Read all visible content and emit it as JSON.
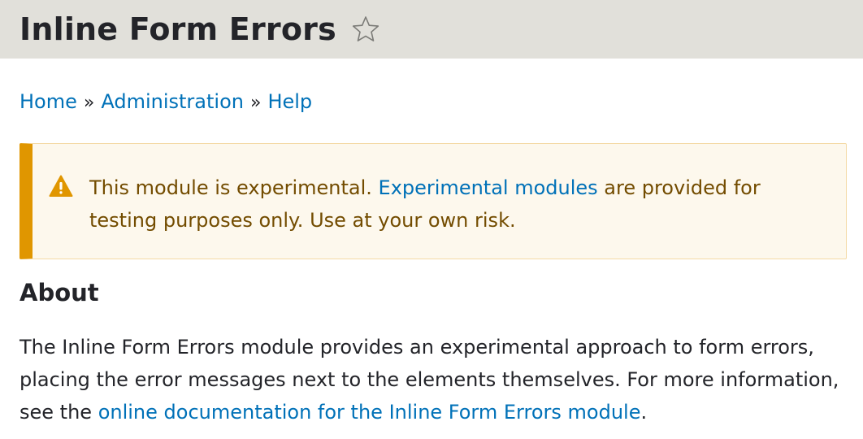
{
  "header": {
    "title": "Inline Form Errors",
    "star_icon": "star-outline-icon"
  },
  "breadcrumb": {
    "items": [
      "Home",
      "Administration",
      "Help"
    ],
    "separator": "»"
  },
  "warning": {
    "icon": "warning-triangle-icon",
    "text_before": "This module is experimental. ",
    "link_text": "Experimental modules",
    "text_after": " are provided for testing purposes only. Use at your own risk.",
    "accent_color": "#e09600",
    "background_color": "#fdf8ed",
    "text_color": "#734c00"
  },
  "about": {
    "heading": "About",
    "text_before": "The Inline Form Errors module provides an experimental approach to form errors, placing the error messages next to the elements themselves. For more information, see the ",
    "link_text": "online documentation for the Inline Form Errors module",
    "text_after": "."
  },
  "colors": {
    "link": "#0071b8",
    "header_background": "#e1e0da",
    "text": "#232429"
  }
}
